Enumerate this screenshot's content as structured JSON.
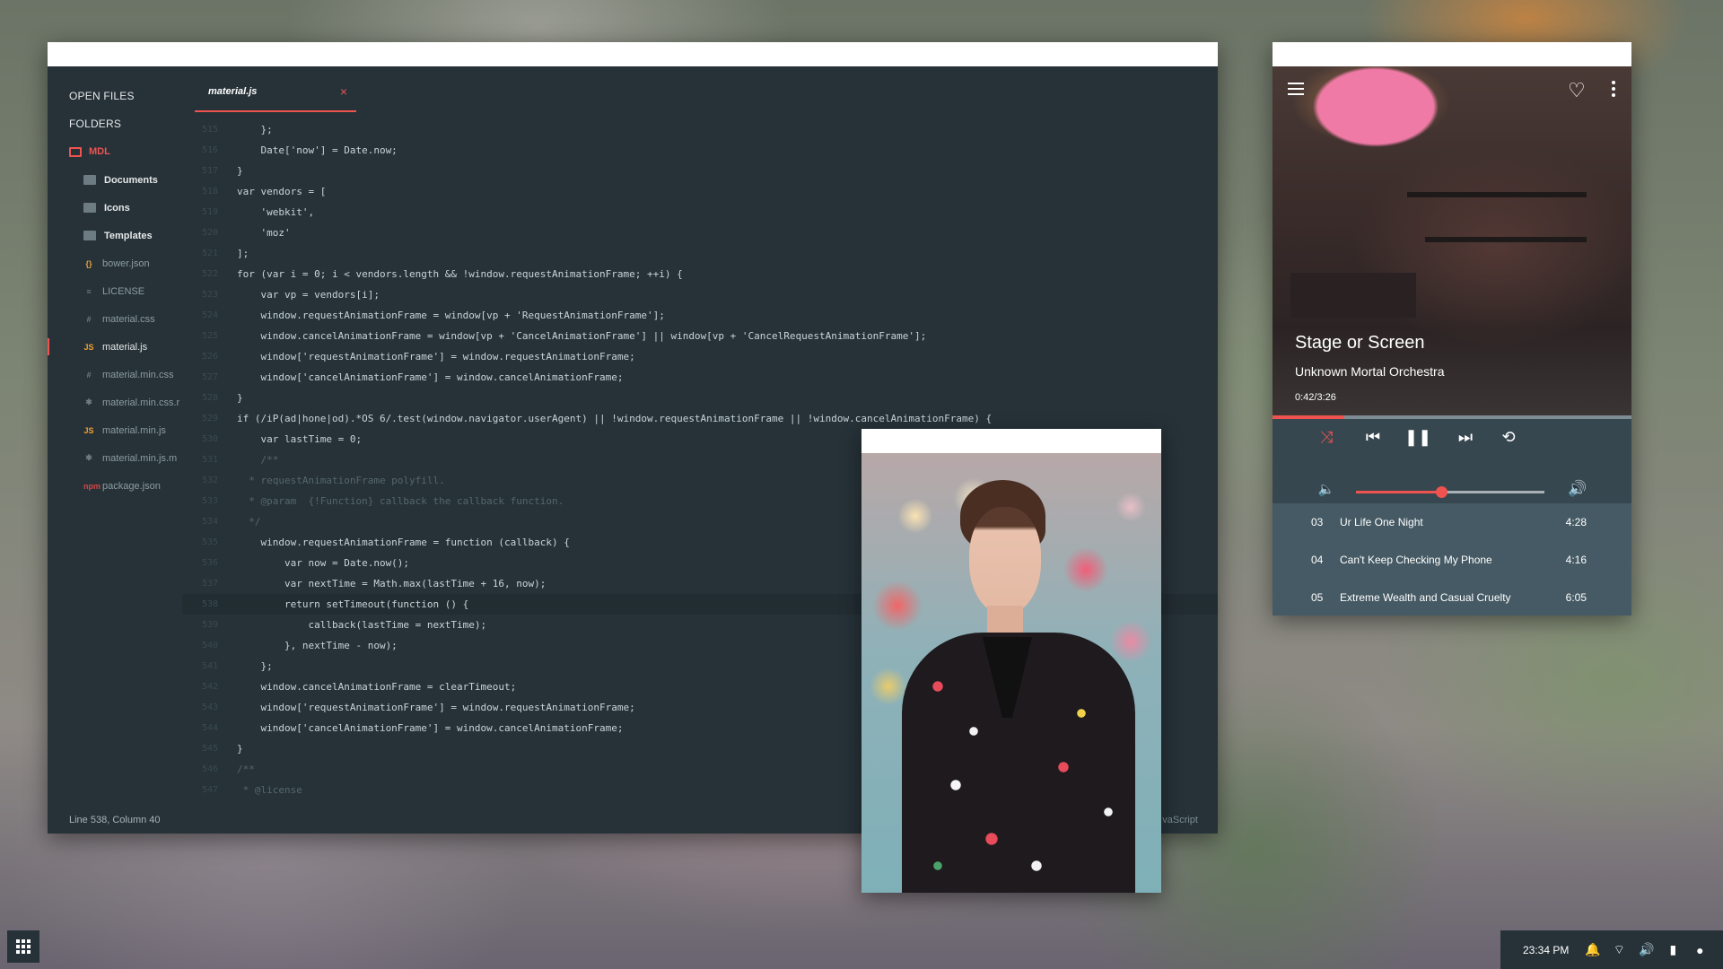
{
  "editor": {
    "sidebar": {
      "open_files_label": "OPEN FILES",
      "folders_label": "FOLDERS",
      "root_folder": "MDL",
      "items": [
        {
          "label": "Documents",
          "icon": "folder-icon",
          "type": "folder"
        },
        {
          "label": "Icons",
          "icon": "folder-icon",
          "type": "folder"
        },
        {
          "label": "Templates",
          "icon": "folder-icon",
          "type": "folder"
        },
        {
          "label": "bower.json",
          "icon": "json-file-icon",
          "glyph": "{}",
          "type": "file"
        },
        {
          "label": "LICENSE",
          "icon": "text-file-icon",
          "glyph": "≡",
          "type": "file"
        },
        {
          "label": "material.css",
          "icon": "css-file-icon",
          "glyph": "#",
          "type": "file"
        },
        {
          "label": "material.js",
          "icon": "js-file-icon",
          "glyph": "JS",
          "type": "file",
          "active": true
        },
        {
          "label": "material.min.css",
          "icon": "css-file-icon",
          "glyph": "#",
          "type": "file"
        },
        {
          "label": "material.min.css.r",
          "icon": "map-file-icon",
          "glyph": "✱",
          "type": "file"
        },
        {
          "label": "material.min.js",
          "icon": "js-file-icon",
          "glyph": "JS",
          "type": "file"
        },
        {
          "label": "material.min.js.m",
          "icon": "map-file-icon",
          "glyph": "✱",
          "type": "file"
        },
        {
          "label": "package.json",
          "icon": "npm-file-icon",
          "glyph": "npm",
          "type": "file"
        }
      ]
    },
    "tab": {
      "label": "material.js",
      "close": "×"
    },
    "code_lines": [
      {
        "n": "515",
        "text": "    };"
      },
      {
        "n": "516",
        "text": "    Date['now'] = Date.now;"
      },
      {
        "n": "517",
        "text": "}"
      },
      {
        "n": "518",
        "text": "var vendors = ["
      },
      {
        "n": "519",
        "text": "    'webkit',"
      },
      {
        "n": "520",
        "text": "    'moz'"
      },
      {
        "n": "521",
        "text": "];"
      },
      {
        "n": "522",
        "text": "for (var i = 0; i < vendors.length && !window.requestAnimationFrame; ++i) {"
      },
      {
        "n": "523",
        "text": "    var vp = vendors[i];"
      },
      {
        "n": "524",
        "text": "    window.requestAnimationFrame = window[vp + 'RequestAnimationFrame'];"
      },
      {
        "n": "525",
        "text": "    window.cancelAnimationFrame = window[vp + 'CancelAnimationFrame'] || window[vp + 'CancelRequestAnimationFrame'];"
      },
      {
        "n": "526",
        "text": "    window['requestAnimationFrame'] = window.requestAnimationFrame;"
      },
      {
        "n": "527",
        "text": "    window['cancelAnimationFrame'] = window.cancelAnimationFrame;"
      },
      {
        "n": "528",
        "text": "}"
      },
      {
        "n": "529",
        "text": "if (/iP(ad|hone|od).*OS 6/.test(window.navigator.userAgent) || !window.requestAnimationFrame || !window.cancelAnimationFrame) {"
      },
      {
        "n": "530",
        "text": "    var lastTime = 0;"
      },
      {
        "n": "531",
        "text": "    /**",
        "comment": true
      },
      {
        "n": "532",
        "text": "  * requestAnimationFrame polyfill.",
        "comment": true
      },
      {
        "n": "533",
        "text": "  * @param  {!Function} callback the callback function.",
        "comment": true
      },
      {
        "n": "534",
        "text": "  */",
        "comment": true
      },
      {
        "n": "535",
        "text": "    window.requestAnimationFrame = function (callback) {"
      },
      {
        "n": "536",
        "text": "        var now = Date.now();"
      },
      {
        "n": "537",
        "text": "        var nextTime = Math.max(lastTime + 16, now);"
      },
      {
        "n": "538",
        "text": "        return setTimeout(function () {",
        "current": true
      },
      {
        "n": "539",
        "text": "            callback(lastTime = nextTime);"
      },
      {
        "n": "540",
        "text": "        }, nextTime - now);"
      },
      {
        "n": "541",
        "text": "    };"
      },
      {
        "n": "542",
        "text": "    window.cancelAnimationFrame = clearTimeout;"
      },
      {
        "n": "543",
        "text": "    window['requestAnimationFrame'] = window.requestAnimationFrame;"
      },
      {
        "n": "544",
        "text": "    window['cancelAnimationFrame'] = window.cancelAnimationFrame;"
      },
      {
        "n": "545",
        "text": "}"
      },
      {
        "n": "546",
        "text": "/**",
        "comment": true
      },
      {
        "n": "547",
        "text": " * @license",
        "comment": true
      }
    ],
    "status": {
      "position": "Line 538, Column 40",
      "language": "vaScript"
    }
  },
  "player": {
    "song_title": "Stage or Screen",
    "artist": "Unknown Mortal Orchestra",
    "time": "0:42/3:26",
    "progress": 0.2,
    "volume": 0.45,
    "tracks": [
      {
        "num": "03",
        "title": "Ur Life One Night",
        "duration": "4:28"
      },
      {
        "num": "04",
        "title": "Can't Keep Checking My Phone",
        "duration": "4:16"
      },
      {
        "num": "05",
        "title": "Extreme Wealth and Casual Cruelty",
        "duration": "6:05"
      }
    ]
  },
  "taskbar": {
    "clock": "23:34 PM"
  },
  "colors": {
    "accent": "#ef5350",
    "editor_bg": "#263238",
    "player_bg": "#37474f"
  }
}
